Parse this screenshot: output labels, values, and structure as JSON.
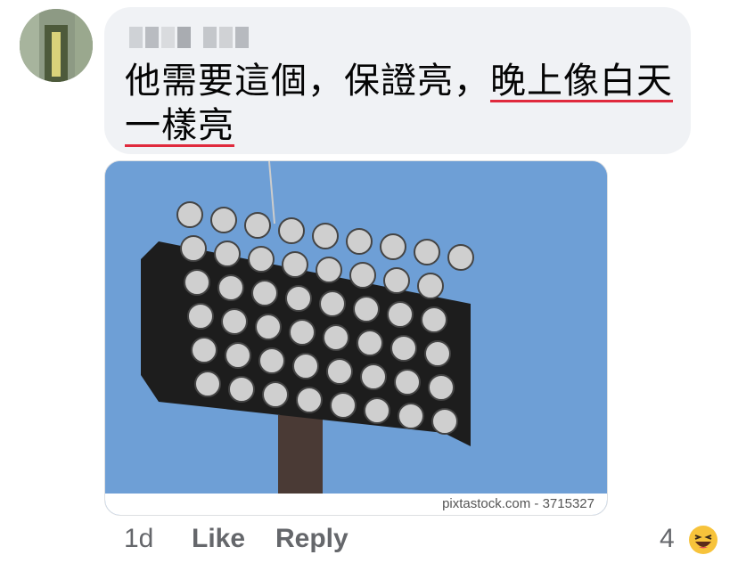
{
  "comment": {
    "author_name": "",
    "text_part1": "他需要這個，保證亮，",
    "text_highlight": "晚上像白天一樣亮",
    "underline_color": "#e02a3d"
  },
  "attachment": {
    "caption": "pixtastock.com - 3715327",
    "sky_color": "#6b9fd8"
  },
  "actions": {
    "timestamp": "1d",
    "like_label": "Like",
    "reply_label": "Reply",
    "reaction_count": "4",
    "reaction_icon": "haha-icon"
  }
}
